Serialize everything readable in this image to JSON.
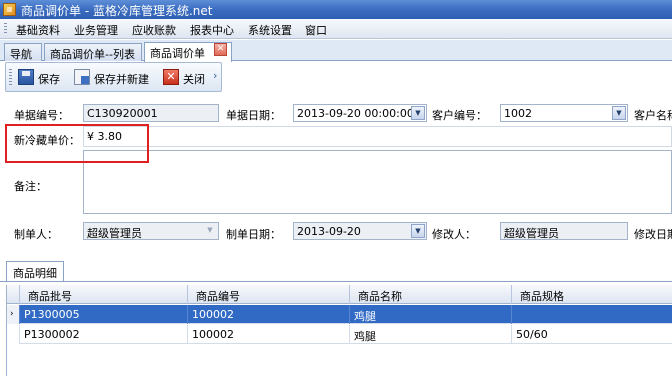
{
  "window": {
    "title": "商品调价单 - 蓝格冷库管理系统.net"
  },
  "menu": [
    "基础资料",
    "业务管理",
    "应收账款",
    "报表中心",
    "系统设置",
    "窗口"
  ],
  "tabs": [
    {
      "label": "导航",
      "active": false
    },
    {
      "label": "商品调价单--列表",
      "active": false
    },
    {
      "label": "商品调价单",
      "active": true
    }
  ],
  "toolbar": {
    "save": "保存",
    "save_new": "保存并新建",
    "close": "关闭"
  },
  "form": {
    "doc_no_label": "单据编号：",
    "doc_no": "C130920001",
    "doc_date_label": "单据日期：",
    "doc_date": "2013-09-20  00:00:00",
    "customer_no_label": "客户编号：",
    "customer_no": "1002",
    "customer_name_label": "客户名称",
    "price_label": "新冷藏单价：",
    "price": "¥ 3.80",
    "remark_label": "备注：",
    "remark": "",
    "creator_label": "制单人：",
    "creator": "超级管理员",
    "create_date_label": "制单日期：",
    "create_date": "2013-09-20",
    "modifier_label": "修改人：",
    "modifier": "超级管理员",
    "modify_date_label": "修改日期"
  },
  "detail": {
    "tab_label": "商品明细",
    "columns": [
      "商品批号",
      "商品编号",
      "商品名称",
      "商品规格"
    ],
    "rows": [
      {
        "batch": "P1300005",
        "code": "100002",
        "name": "鸡腿",
        "spec": "",
        "selected": true
      },
      {
        "batch": "P1300002",
        "code": "100002",
        "name": "鸡腿",
        "spec": "50/60",
        "selected": false
      }
    ]
  },
  "colors": {
    "highlight": "#e02020",
    "selection": "#316ac5"
  }
}
